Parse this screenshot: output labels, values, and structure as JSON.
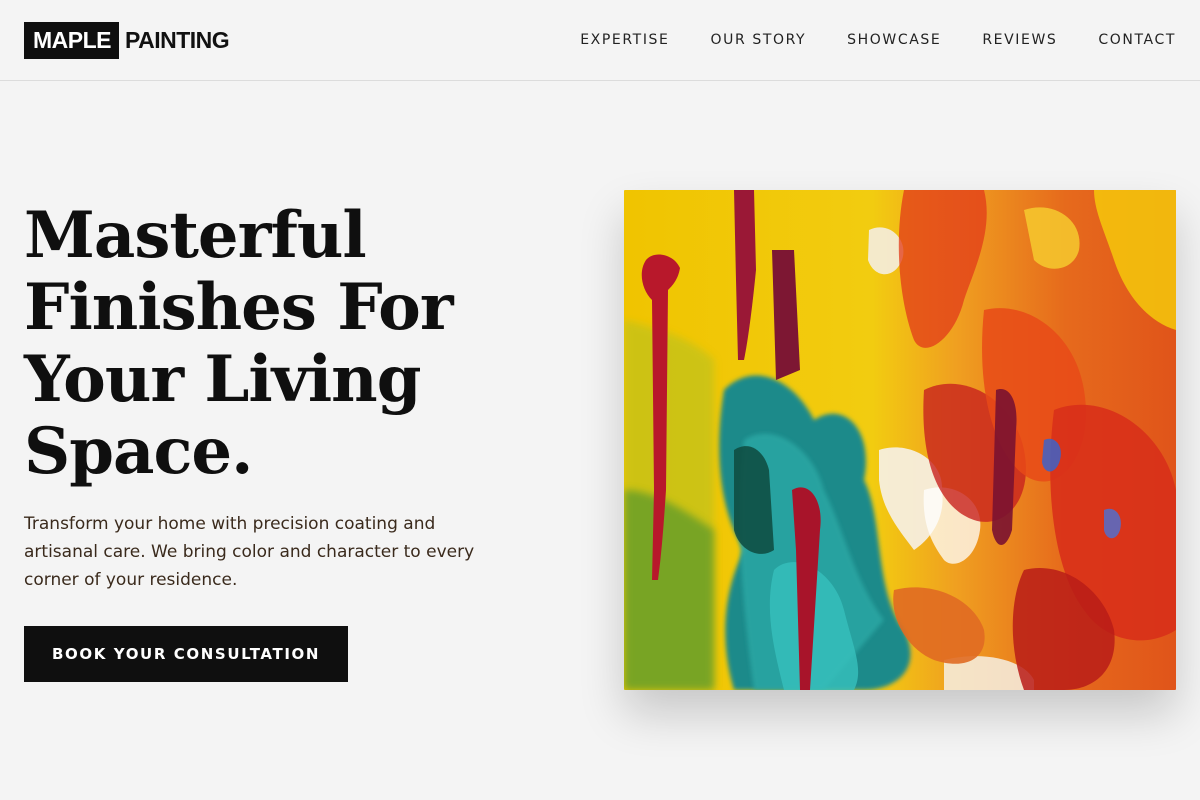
{
  "brand": {
    "box_text": "MAPLE",
    "rest_text": "PAINTING"
  },
  "nav": {
    "items": [
      {
        "label": "EXPERTISE"
      },
      {
        "label": "OUR STORY"
      },
      {
        "label": "SHOWCASE"
      },
      {
        "label": "REVIEWS"
      },
      {
        "label": "CONTACT"
      }
    ]
  },
  "hero": {
    "title_lines": [
      "Masterful",
      "Finishes For",
      "Your Living",
      "Space."
    ],
    "subtitle": "Transform your home with precision coating and artisanal care. We bring color and character to every corner of your residence.",
    "cta_label": "BOOK YOUR CONSULTATION"
  },
  "artwork": {
    "description_icon": "abstract-painting-image",
    "colors": {
      "yellow": "#f2c800",
      "orange": "#e8561a",
      "red": "#c71f1f",
      "teal": "#1a8f8c",
      "crimson": "#8c1b3a",
      "white": "#f4ede0"
    }
  },
  "theme": {
    "background": "#f4f4f4",
    "ink": "#0f0f0f",
    "subtitle_color": "#3a2a1c"
  }
}
